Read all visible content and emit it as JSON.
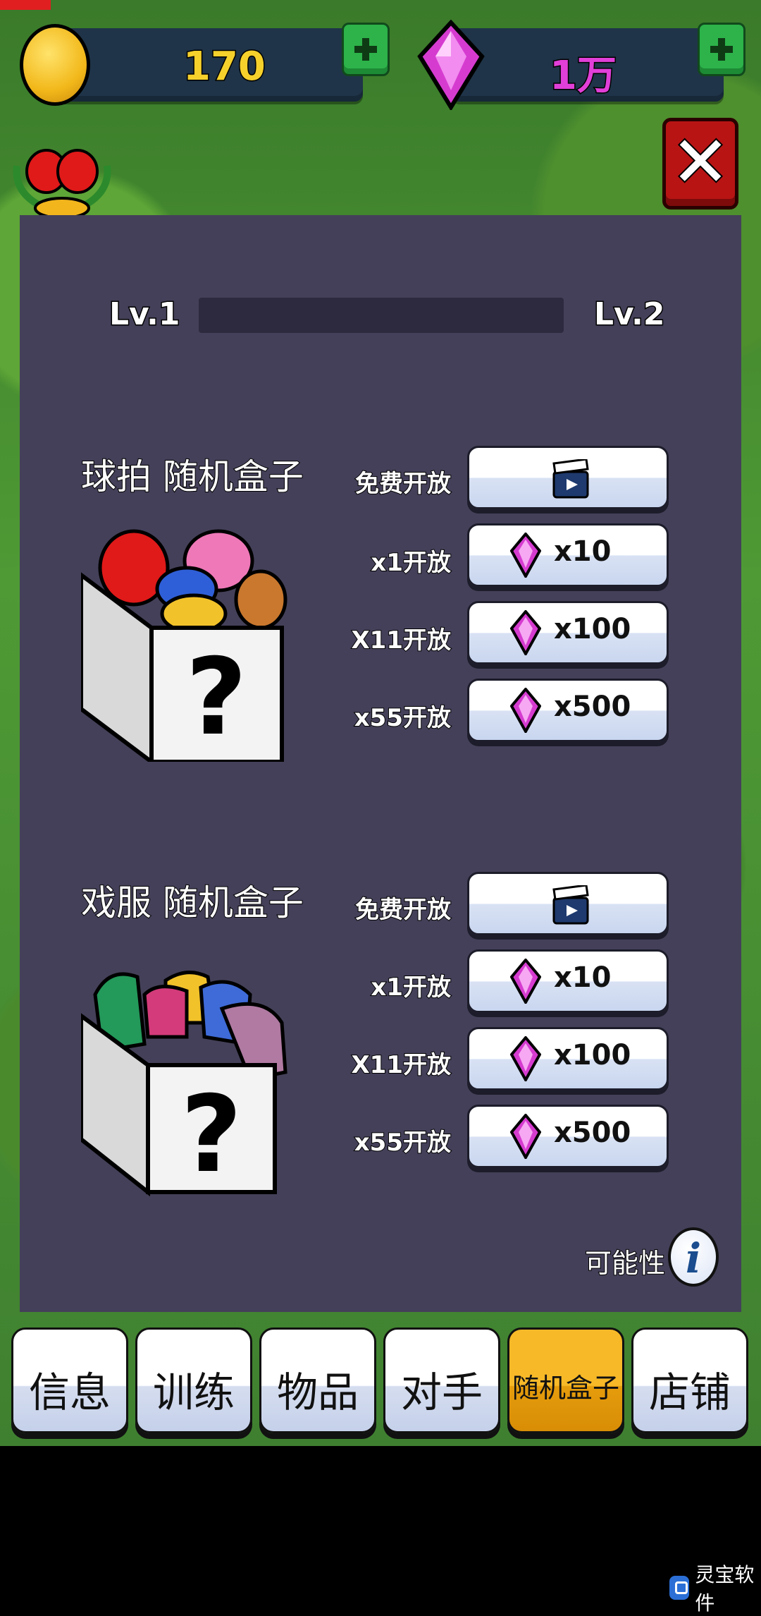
{
  "currency": {
    "coins": "170",
    "gems": "1万"
  },
  "level": {
    "current": "Lv.1",
    "next": "Lv.2",
    "progress": 0
  },
  "boxes": [
    {
      "title": "球拍 随机盒子",
      "options": [
        {
          "label": "免费开放",
          "type": "video",
          "icon": "video-clapper-icon"
        },
        {
          "label": "x1开放",
          "type": "gem",
          "cost": "x10",
          "icon": "gem-icon"
        },
        {
          "label": "X11开放",
          "type": "gem",
          "cost": "x100",
          "icon": "gem-icon"
        },
        {
          "label": "x55开放",
          "type": "gem",
          "cost": "x500",
          "icon": "gem-icon"
        }
      ]
    },
    {
      "title": "戏服 随机盒子",
      "options": [
        {
          "label": "免费开放",
          "type": "video",
          "icon": "video-clapper-icon"
        },
        {
          "label": "x1开放",
          "type": "gem",
          "cost": "x10",
          "icon": "gem-icon"
        },
        {
          "label": "X11开放",
          "type": "gem",
          "cost": "x100",
          "icon": "gem-icon"
        },
        {
          "label": "x55开放",
          "type": "gem",
          "cost": "x500",
          "icon": "gem-icon"
        }
      ]
    }
  ],
  "probability_label": "可能性",
  "tabs": [
    {
      "label": "信息",
      "active": false
    },
    {
      "label": "训练",
      "active": false
    },
    {
      "label": "物品",
      "active": false
    },
    {
      "label": "对手",
      "active": false
    },
    {
      "label": "随机盒子",
      "active": true
    },
    {
      "label": "店铺",
      "active": false
    }
  ],
  "watermark": "灵宝软件",
  "colors": {
    "panel": "#444059",
    "active_tab": "#f0aa18",
    "coin_text": "#f6d12b",
    "gem_text": "#e13fd8",
    "close_button": "#b81414"
  }
}
